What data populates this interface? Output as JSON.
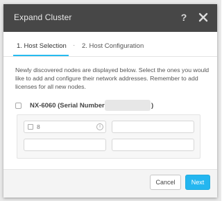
{
  "dialog": {
    "title": "Expand Cluster",
    "help_icon": "?"
  },
  "tabs": [
    {
      "label": "1. Host Selection",
      "active": true
    },
    {
      "label": "2. Host Configuration",
      "active": false
    }
  ],
  "tab_separator": "·",
  "description": "Newly discovered nodes are displayed below. Select the ones you would like to add and configure their network addresses. Remember to add licenses for all new nodes.",
  "node": {
    "label": "NX-6060 (Serial Number:",
    "label_suffix": ")",
    "fields": [
      {
        "value": "8",
        "has_checkbox": true,
        "has_info_icon": true
      },
      {
        "value": "",
        "has_checkbox": false,
        "has_info_icon": false
      },
      {
        "value": "",
        "has_checkbox": false,
        "has_info_icon": false
      },
      {
        "value": "",
        "has_checkbox": false,
        "has_info_icon": false
      }
    ]
  },
  "info_icon_glyph": "i",
  "footer": {
    "cancel_label": "Cancel",
    "next_label": "Next"
  },
  "colors": {
    "titlebar": "#474747",
    "accent": "#24b6f0"
  }
}
